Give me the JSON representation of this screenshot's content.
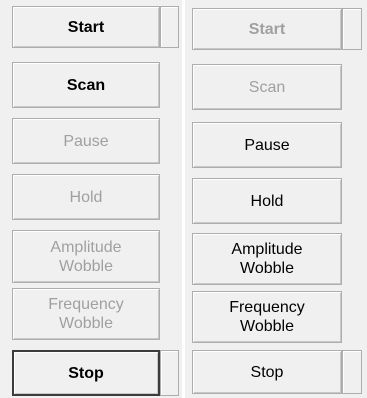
{
  "left_panel": {
    "start": {
      "label": "Start",
      "enabled": true
    },
    "scan": {
      "label": "Scan",
      "enabled": true
    },
    "pause": {
      "label": "Pause",
      "enabled": false
    },
    "hold": {
      "label": "Hold",
      "enabled": false
    },
    "amplitude_wobble": {
      "line1": "Amplitude",
      "line2": "Wobble",
      "enabled": false
    },
    "frequency_wobble": {
      "line1": "Frequency",
      "line2": "Wobble",
      "enabled": false
    },
    "stop": {
      "label": "Stop",
      "enabled": true
    }
  },
  "right_panel": {
    "start": {
      "label": "Start",
      "enabled": false
    },
    "scan": {
      "label": "Scan",
      "enabled": false
    },
    "pause": {
      "label": "Pause",
      "enabled": true
    },
    "hold": {
      "label": "Hold",
      "enabled": true
    },
    "amplitude_wobble": {
      "line1": "Amplitude",
      "line2": "Wobble",
      "enabled": true
    },
    "frequency_wobble": {
      "line1": "Frequency",
      "line2": "Wobble",
      "enabled": true
    },
    "stop": {
      "label": "Stop",
      "enabled": true
    }
  },
  "colors": {
    "enabled_text": "#000000",
    "disabled_text": "#a0a0a0",
    "button_face": "#f0f0f0",
    "button_border": "#adadad"
  }
}
